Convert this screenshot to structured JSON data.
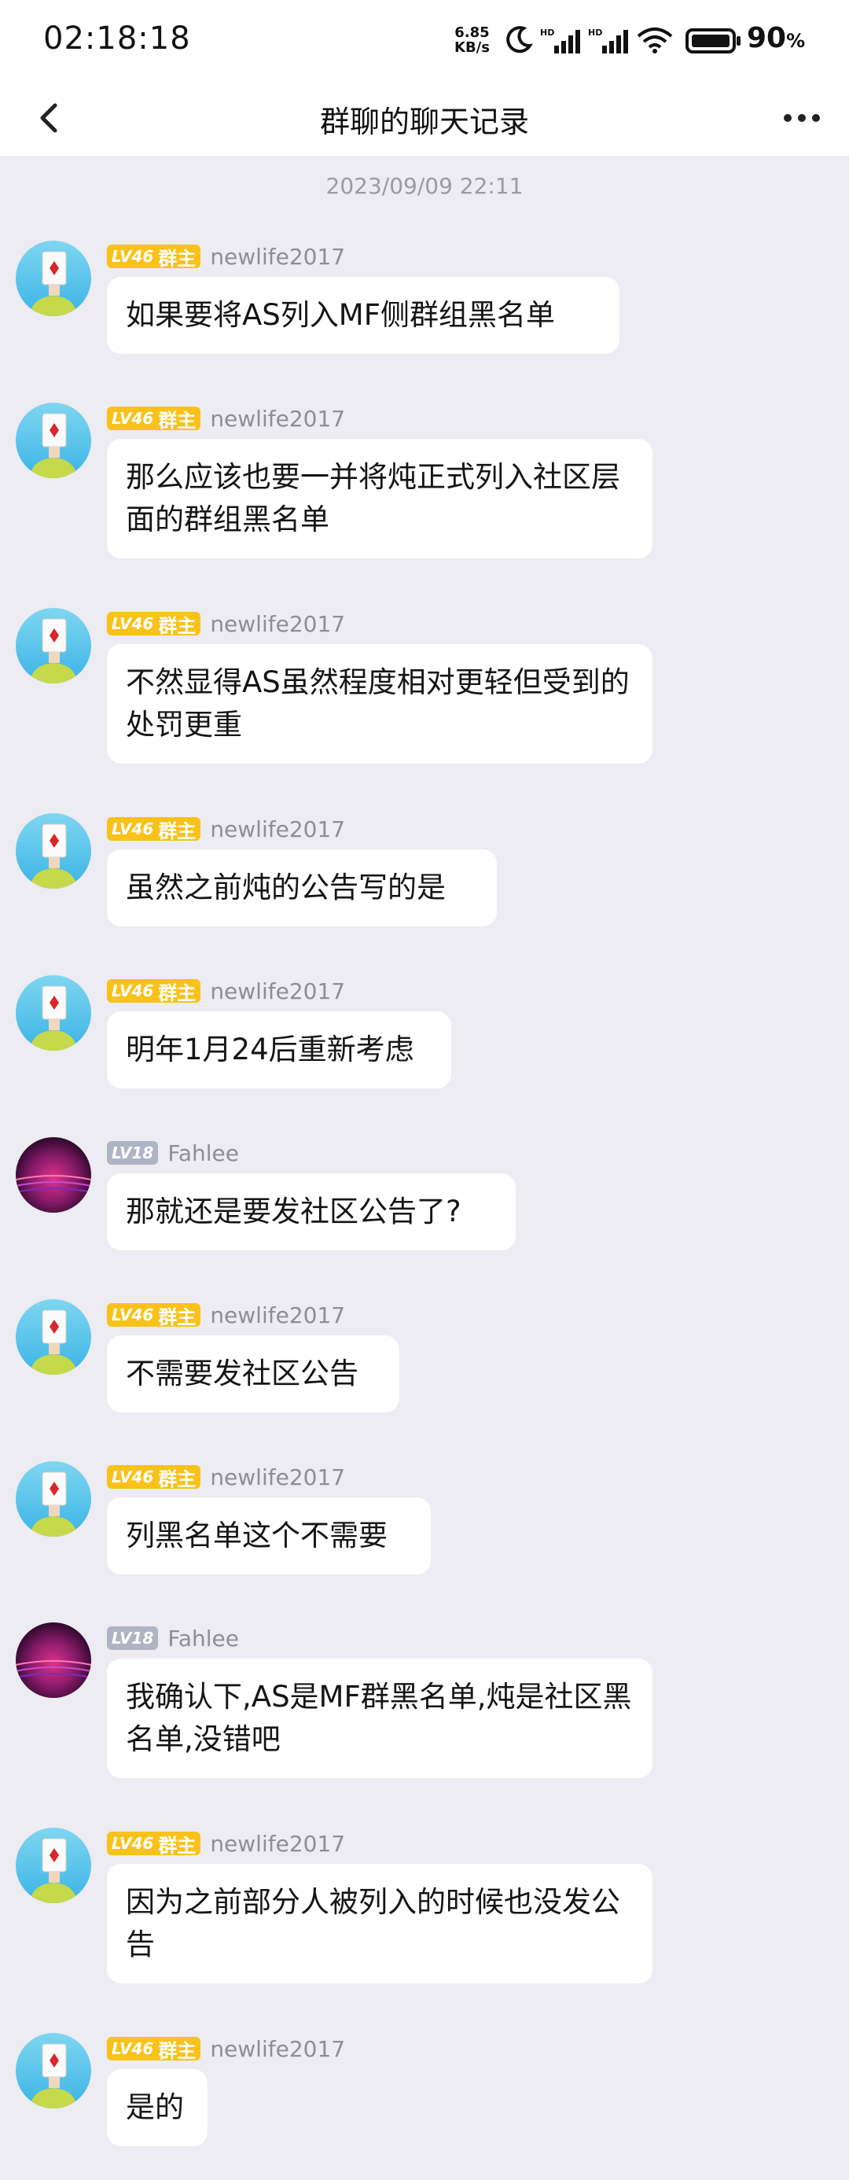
{
  "status_bar": {
    "time": "02:18:18",
    "net_speed_value": "6.85",
    "net_speed_unit": "KB/s",
    "battery_percent": "90",
    "battery_unit": "%",
    "icons": [
      "moon-icon",
      "hd-signal-icon",
      "hd-signal-icon",
      "wifi-icon",
      "battery-icon"
    ]
  },
  "header": {
    "title": "群聊的聊天记录",
    "back_icon": "chevron-left-icon",
    "more_icon": "more-dots-icon"
  },
  "timestamp": "2023/09/09 22:11",
  "colors": {
    "background": "#ececf2",
    "bubble": "#ffffff",
    "owner_badge": "#f9c21a",
    "member_badge": "#b0b3c4",
    "username": "#8d8d96"
  },
  "messages": [
    {
      "user": "newlife2017",
      "level": "LV46",
      "role": "群主",
      "text": "如果要将AS列入MF侧群组黑名单"
    },
    {
      "user": "newlife2017",
      "level": "LV46",
      "role": "群主",
      "text": "那么应该也要一并将炖正式列入社区层面的群组黑名单"
    },
    {
      "user": "newlife2017",
      "level": "LV46",
      "role": "群主",
      "text": "不然显得AS虽然程度相对更轻但受到的处罚更重"
    },
    {
      "user": "newlife2017",
      "level": "LV46",
      "role": "群主",
      "text": "虽然之前炖的公告写的是"
    },
    {
      "user": "newlife2017",
      "level": "LV46",
      "role": "群主",
      "text": "明年1月24后重新考虑"
    },
    {
      "user": "Fahlee",
      "level": "LV18",
      "role": "",
      "text": "那就还是要发社区公告了?"
    },
    {
      "user": "newlife2017",
      "level": "LV46",
      "role": "群主",
      "text": "不需要发社区公告"
    },
    {
      "user": "newlife2017",
      "level": "LV46",
      "role": "群主",
      "text": "列黑名单这个不需要"
    },
    {
      "user": "Fahlee",
      "level": "LV18",
      "role": "",
      "text": "我确认下,AS是MF群黑名单,炖是社区黑名单,没错吧"
    },
    {
      "user": "newlife2017",
      "level": "LV46",
      "role": "群主",
      "text": "因为之前部分人被列入的时候也没发公告"
    },
    {
      "user": "newlife2017",
      "level": "LV46",
      "role": "群主",
      "text": "是的"
    }
  ]
}
